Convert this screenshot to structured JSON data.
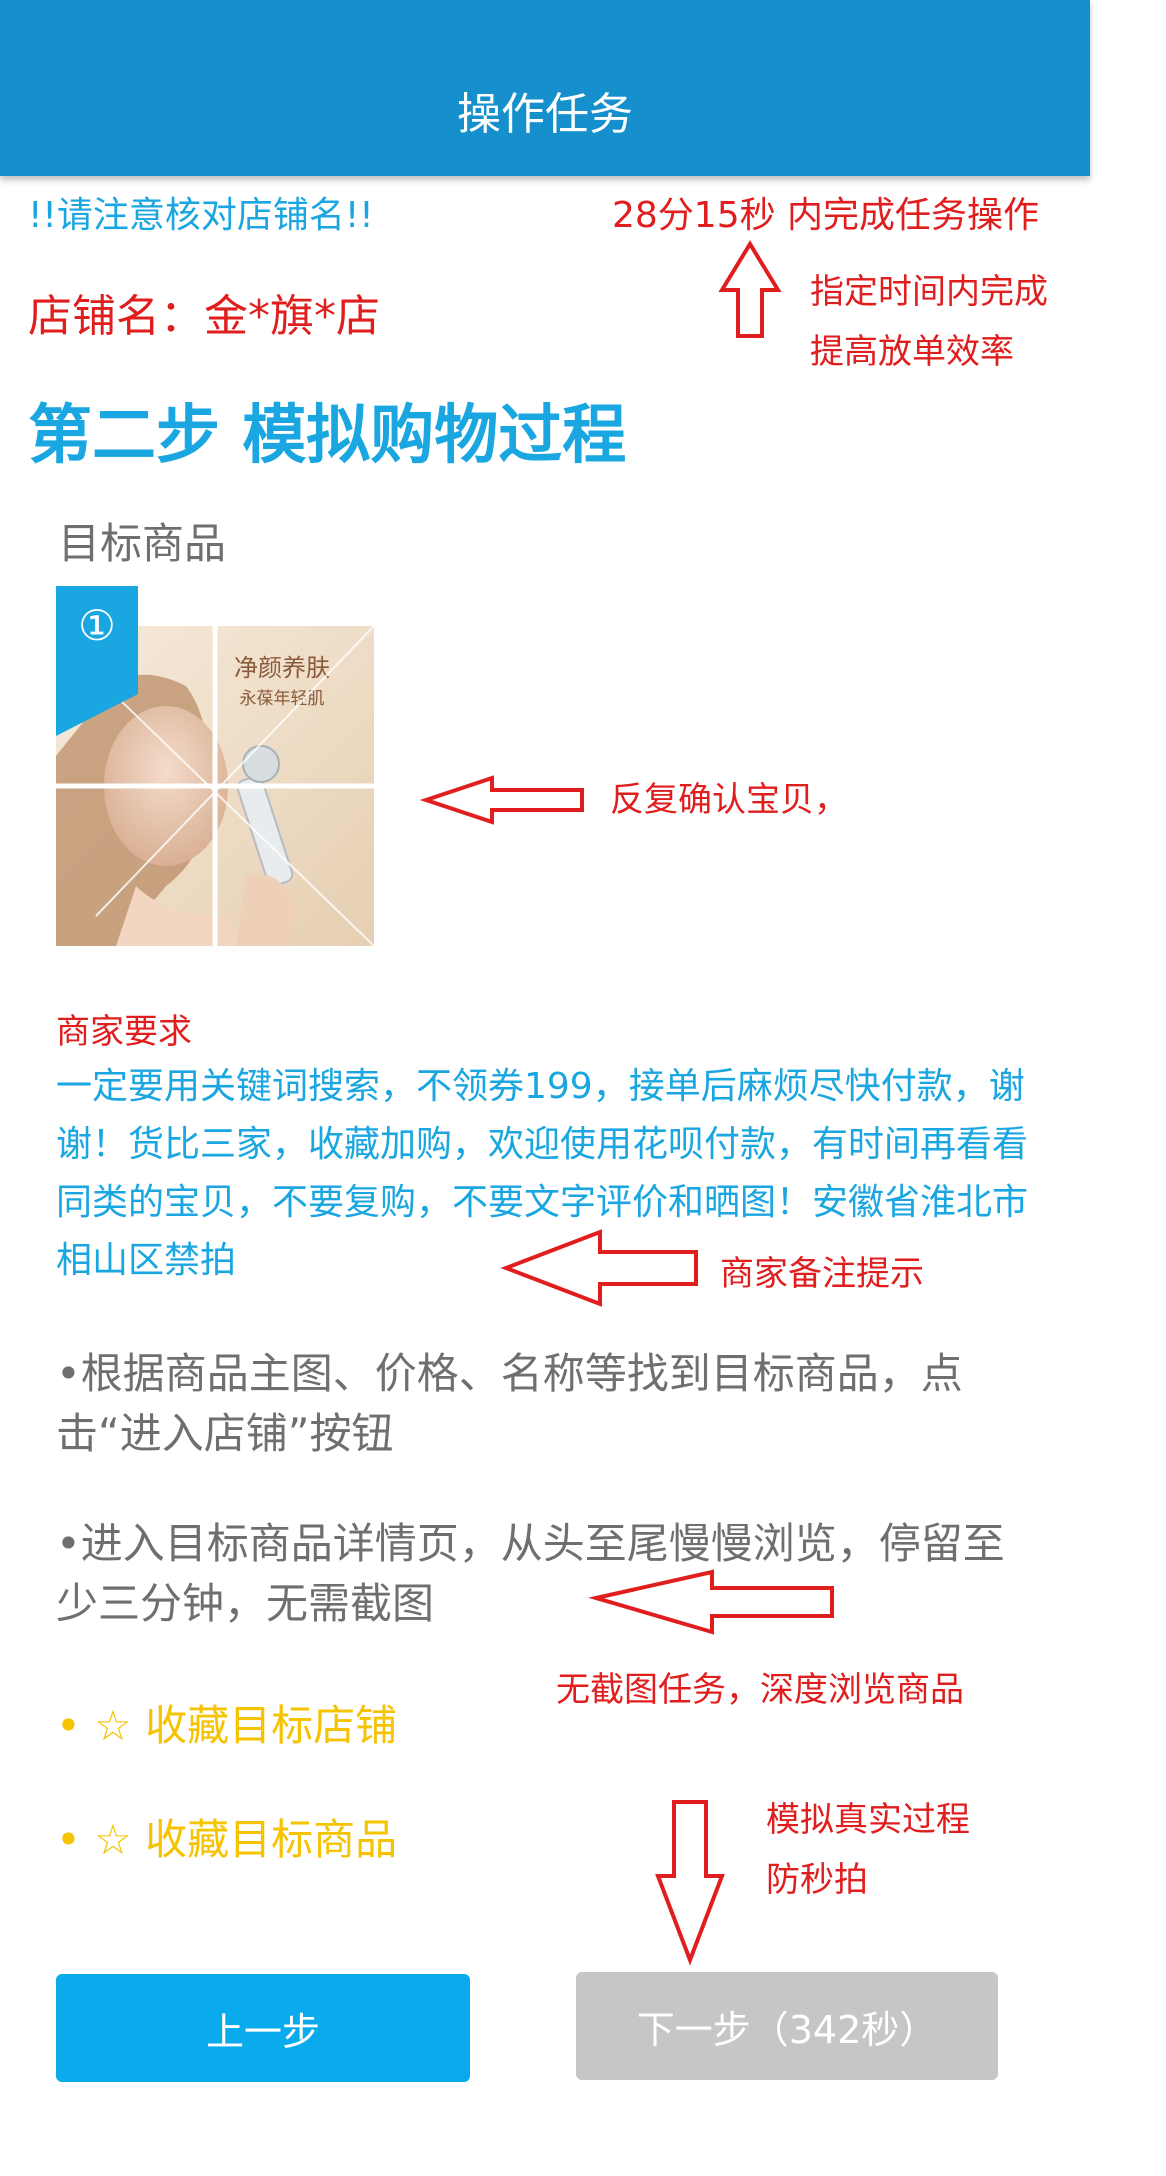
{
  "header": {
    "title": "操作任务"
  },
  "notice": "!!请注意核对店铺名!!",
  "timer": "28分15秒 内完成任务操作",
  "shop": {
    "label": "店铺名：",
    "name": "金*旗*店"
  },
  "step_title": "第二步 模拟购物过程",
  "target_label": "目标商品",
  "product": {
    "badge": "①",
    "headline": "净颜养肤",
    "subline": "永葆年轻肌"
  },
  "merchant": {
    "label": "商家要求",
    "text": "一定要用关键词搜索，不领券199，接单后麻烦尽快付款，谢谢！货比三家，收藏加购，欢迎使用花呗付款，有时间再看看同类的宝贝，不要复购，不要文字评价和晒图！安徽省淮北市相山区禁拍"
  },
  "instructions": [
    "•根据商品主图、价格、名称等找到目标商品，点击“进入店铺”按钮",
    "•进入目标商品详情页，从头至尾慢慢浏览，停留至少三分钟，无需截图"
  ],
  "favorites": [
    {
      "bullet": "•",
      "star": "☆",
      "label": "收藏目标店铺"
    },
    {
      "bullet": "•",
      "star": "☆",
      "label": "收藏目标商品"
    }
  ],
  "buttons": {
    "prev": "上一步",
    "next": "下一步（342秒）"
  },
  "annotations": {
    "timer_note_1": "指定时间内完成",
    "timer_note_2": "提高放单效率",
    "product_note": "反复确认宝贝，",
    "merchant_note": "商家备注提示",
    "browse_note": "无截图任务，深度浏览商品",
    "sim_note_1": "模拟真实过程",
    "sim_note_2": "防秒拍"
  },
  "colors": {
    "header": "#1590cc",
    "accent_blue": "#1aa6e0",
    "annotation_red": "#e01e1e",
    "favorite_gold": "#f5c300",
    "prev_button": "#0aabec",
    "next_button_disabled": "#c6c6c6"
  }
}
